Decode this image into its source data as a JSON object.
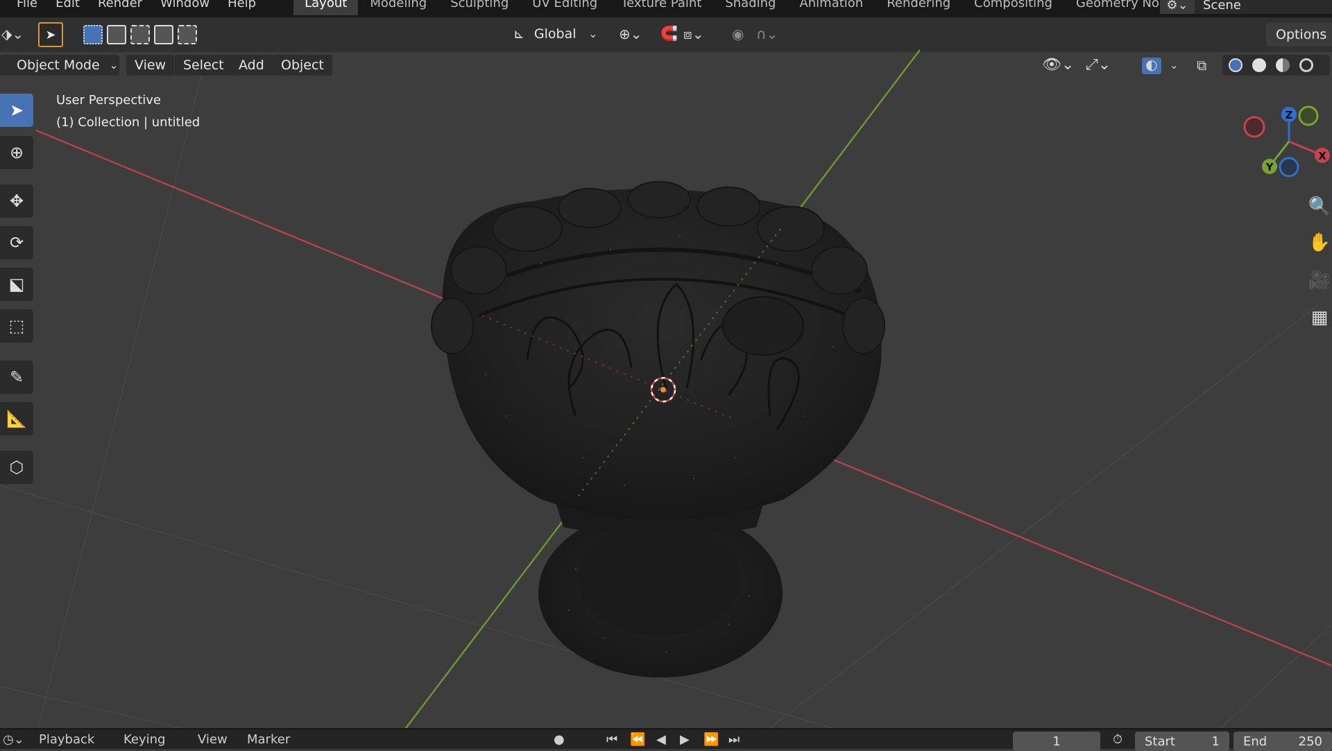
{
  "menubar": {
    "items": [
      "File",
      "Edit",
      "Render",
      "Window",
      "Help"
    ],
    "workspaces": [
      "Layout",
      "Modeling",
      "Sculpting",
      "UV Editing",
      "Texture Paint",
      "Shading",
      "Animation",
      "Rendering",
      "Compositing",
      "Geometry Nod"
    ],
    "active_workspace": "Layout",
    "scene_label": "Scene"
  },
  "tool_header": {
    "transform_orientation": "Global",
    "options_label": "Options"
  },
  "viewport_header": {
    "mode": "Object Mode",
    "menus": [
      "View",
      "Select",
      "Add",
      "Object"
    ]
  },
  "viewport": {
    "perspective_label": "User Perspective",
    "collection_label": "(1) Collection | untitled",
    "gizmo_axes": {
      "x": "X",
      "y": "Y",
      "z": "Z"
    },
    "colors": {
      "x_axis": "#c8424f",
      "y_axis": "#7aa233",
      "z_axis": "#2f6fce",
      "background": "#3d3d3d"
    }
  },
  "timeline": {
    "menus": [
      "Playback",
      "Keying",
      "View",
      "Marker"
    ],
    "current_frame": "1",
    "start_label": "Start",
    "start_value": "1",
    "end_label": "End",
    "end_value": "250"
  }
}
